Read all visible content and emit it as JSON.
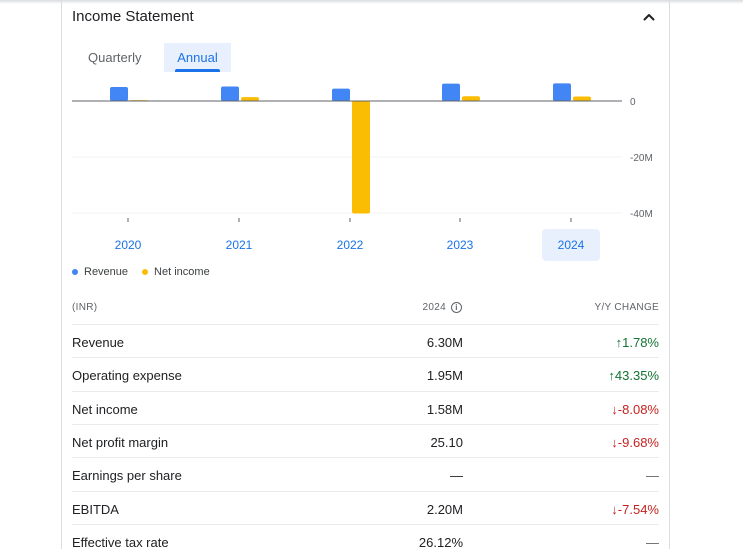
{
  "section": {
    "title": "Income Statement"
  },
  "tabs": [
    {
      "label": "Quarterly",
      "selected": false
    },
    {
      "label": "Annual",
      "selected": true
    }
  ],
  "colors": {
    "revenue": "#4285f4",
    "net_income": "#fbbc04",
    "accent": "#1a73e8",
    "positive": "#137333",
    "negative": "#c5221f"
  },
  "chart_data": {
    "type": "bar",
    "categories": [
      "2020",
      "2021",
      "2022",
      "2023",
      "2024"
    ],
    "selected_category": "2024",
    "series": [
      {
        "name": "Revenue",
        "values": [
          5.0,
          5.2,
          4.4,
          6.2,
          6.3
        ]
      },
      {
        "name": "Net income",
        "values": [
          0.3,
          1.4,
          -40.2,
          1.7,
          1.6
        ]
      }
    ],
    "y_ticks": [
      "0",
      "-20M",
      "-40M"
    ],
    "y_tick_values": [
      0,
      -20,
      -40
    ],
    "ylim": [
      -40.5,
      7
    ],
    "unit": "M",
    "legend_position": "bottom-left",
    "grid": true
  },
  "table": {
    "header": {
      "currency": "(INR)",
      "year": "2024",
      "change": "Y/Y CHANGE"
    },
    "rows": [
      {
        "label": "Revenue",
        "value": "6.30M",
        "change": "↑1.78%",
        "trend": "up"
      },
      {
        "label": "Operating expense",
        "value": "1.95M",
        "change": "↑43.35%",
        "trend": "up"
      },
      {
        "label": "Net income",
        "value": "1.58M",
        "change": "↓-8.08%",
        "trend": "down"
      },
      {
        "label": "Net profit margin",
        "value": "25.10",
        "change": "↓-9.68%",
        "trend": "down"
      },
      {
        "label": "Earnings per share",
        "value": "—",
        "change": "—",
        "trend": "none"
      },
      {
        "label": "EBITDA",
        "value": "2.20M",
        "change": "↓-7.54%",
        "trend": "down"
      },
      {
        "label": "Effective tax rate",
        "value": "26.12%",
        "change": "—",
        "trend": "none"
      }
    ]
  }
}
